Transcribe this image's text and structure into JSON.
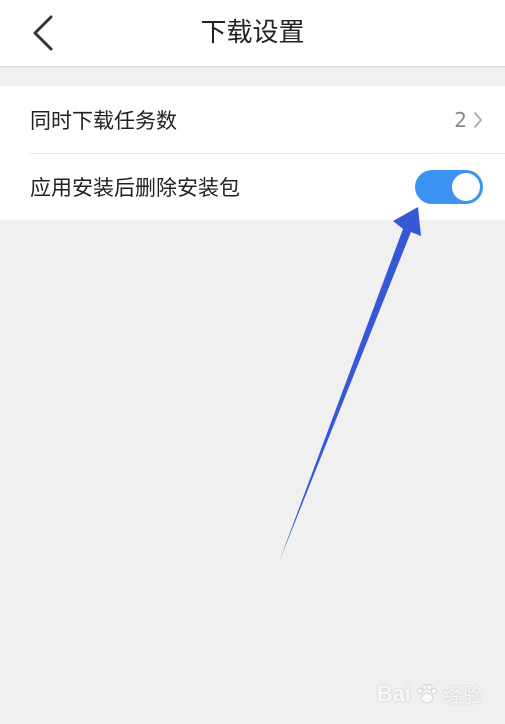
{
  "header": {
    "title": "下载设置",
    "back_icon": "chevron-left-icon"
  },
  "settings": [
    {
      "label": "同时下载任务数",
      "value": "2",
      "icon": "chevron-right-icon"
    },
    {
      "label": "应用安装后删除安装包",
      "toggle_on": true
    }
  ],
  "watermark": {
    "brand": "Bai",
    "suffix": "经验"
  },
  "colors": {
    "toggle_on": "#3c93f2",
    "annotation_arrow": "#3559d6",
    "background": "#f0f0f0"
  }
}
